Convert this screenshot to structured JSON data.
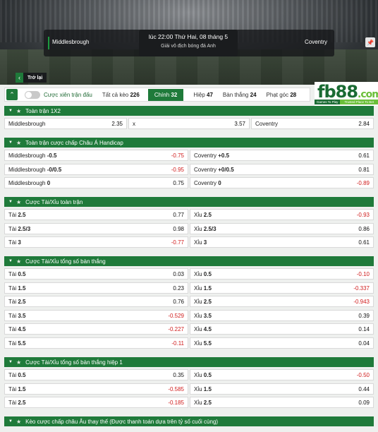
{
  "match": {
    "home": "Middlesbrough",
    "away": "Coventry",
    "kickoff": "lúc 22:00 Thứ Hai, 08 tháng 5",
    "league": "Giải vô địch bóng đá Anh",
    "back_label": "Trở lại"
  },
  "filters": {
    "parlay_label": "Cược xiên trận đấu",
    "tabs": [
      {
        "label": "Tất cả kèo",
        "count": "226"
      },
      {
        "label": "Chính",
        "count": "32"
      },
      {
        "label": "Hiệp",
        "count": "47"
      },
      {
        "label": "Bàn thắng",
        "count": "24"
      },
      {
        "label": "Phạt góc",
        "count": "28"
      }
    ]
  },
  "logo": {
    "main": "fb88",
    "suffix": ".com",
    "tag1": "Games To Play",
    "tag2": "Trusted Place To Bet"
  },
  "sections": [
    {
      "title": "Toàn trận 1X2",
      "rows": [
        [
          {
            "name": "Middlesbrough",
            "line": "",
            "odd": "2.35"
          },
          {
            "name": "x",
            "line": "",
            "odd": "3.57"
          },
          {
            "name": "Coventry",
            "line": "",
            "odd": "2.84"
          }
        ]
      ]
    },
    {
      "title": "Toàn trận cược chấp Châu Á Handicap",
      "rows": [
        [
          {
            "name": "Middlesbrough",
            "line": "-0.5",
            "odd": "-0.75"
          },
          {
            "name": "Coventry",
            "line": "+0.5",
            "odd": "0.61"
          }
        ],
        [
          {
            "name": "Middlesbrough",
            "line": "-0/0.5",
            "odd": "-0.95"
          },
          {
            "name": "Coventry",
            "line": "+0/0.5",
            "odd": "0.81"
          }
        ],
        [
          {
            "name": "Middlesbrough",
            "line": "0",
            "odd": "0.75"
          },
          {
            "name": "Coventry",
            "line": "0",
            "odd": "-0.89"
          }
        ]
      ]
    },
    {
      "title": "Cược Tài/Xỉu toàn trận",
      "rows": [
        [
          {
            "name": "Tài",
            "line": "2.5",
            "odd": "0.77"
          },
          {
            "name": "Xỉu",
            "line": "2.5",
            "odd": "-0.93"
          }
        ],
        [
          {
            "name": "Tài",
            "line": "2.5/3",
            "odd": "0.98"
          },
          {
            "name": "Xỉu",
            "line": "2.5/3",
            "odd": "0.86"
          }
        ],
        [
          {
            "name": "Tài",
            "line": "3",
            "odd": "-0.77"
          },
          {
            "name": "Xỉu",
            "line": "3",
            "odd": "0.61"
          }
        ]
      ]
    },
    {
      "title": "Cược Tài/Xỉu tổng số bàn thắng",
      "rows": [
        [
          {
            "name": "Tài",
            "line": "0.5",
            "odd": "0.03"
          },
          {
            "name": "Xỉu",
            "line": "0.5",
            "odd": "-0.10"
          }
        ],
        [
          {
            "name": "Tài",
            "line": "1.5",
            "odd": "0.23"
          },
          {
            "name": "Xỉu",
            "line": "1.5",
            "odd": "-0.337"
          }
        ],
        [
          {
            "name": "Tài",
            "line": "2.5",
            "odd": "0.76"
          },
          {
            "name": "Xỉu",
            "line": "2.5",
            "odd": "-0.943"
          }
        ],
        [
          {
            "name": "Tài",
            "line": "3.5",
            "odd": "-0.529"
          },
          {
            "name": "Xỉu",
            "line": "3.5",
            "odd": "0.39"
          }
        ],
        [
          {
            "name": "Tài",
            "line": "4.5",
            "odd": "-0.227"
          },
          {
            "name": "Xỉu",
            "line": "4.5",
            "odd": "0.14"
          }
        ],
        [
          {
            "name": "Tài",
            "line": "5.5",
            "odd": "-0.11"
          },
          {
            "name": "Xỉu",
            "line": "5.5",
            "odd": "0.04"
          }
        ]
      ]
    },
    {
      "title": "Cược Tài/Xỉu tổng số bàn thắng hiệp 1",
      "rows": [
        [
          {
            "name": "Tài",
            "line": "0.5",
            "odd": "0.35"
          },
          {
            "name": "Xỉu",
            "line": "0.5",
            "odd": "-0.50"
          }
        ],
        [
          {
            "name": "Tài",
            "line": "1.5",
            "odd": "-0.585"
          },
          {
            "name": "Xỉu",
            "line": "1.5",
            "odd": "0.44"
          }
        ],
        [
          {
            "name": "Tài",
            "line": "2.5",
            "odd": "-0.185"
          },
          {
            "name": "Xỉu",
            "line": "2.5",
            "odd": "0.09"
          }
        ]
      ]
    },
    {
      "title": "Kèo cược chấp châu Âu thay thế (Được thanh toán dựa trên tỷ số cuối cùng)",
      "rows": []
    }
  ]
}
